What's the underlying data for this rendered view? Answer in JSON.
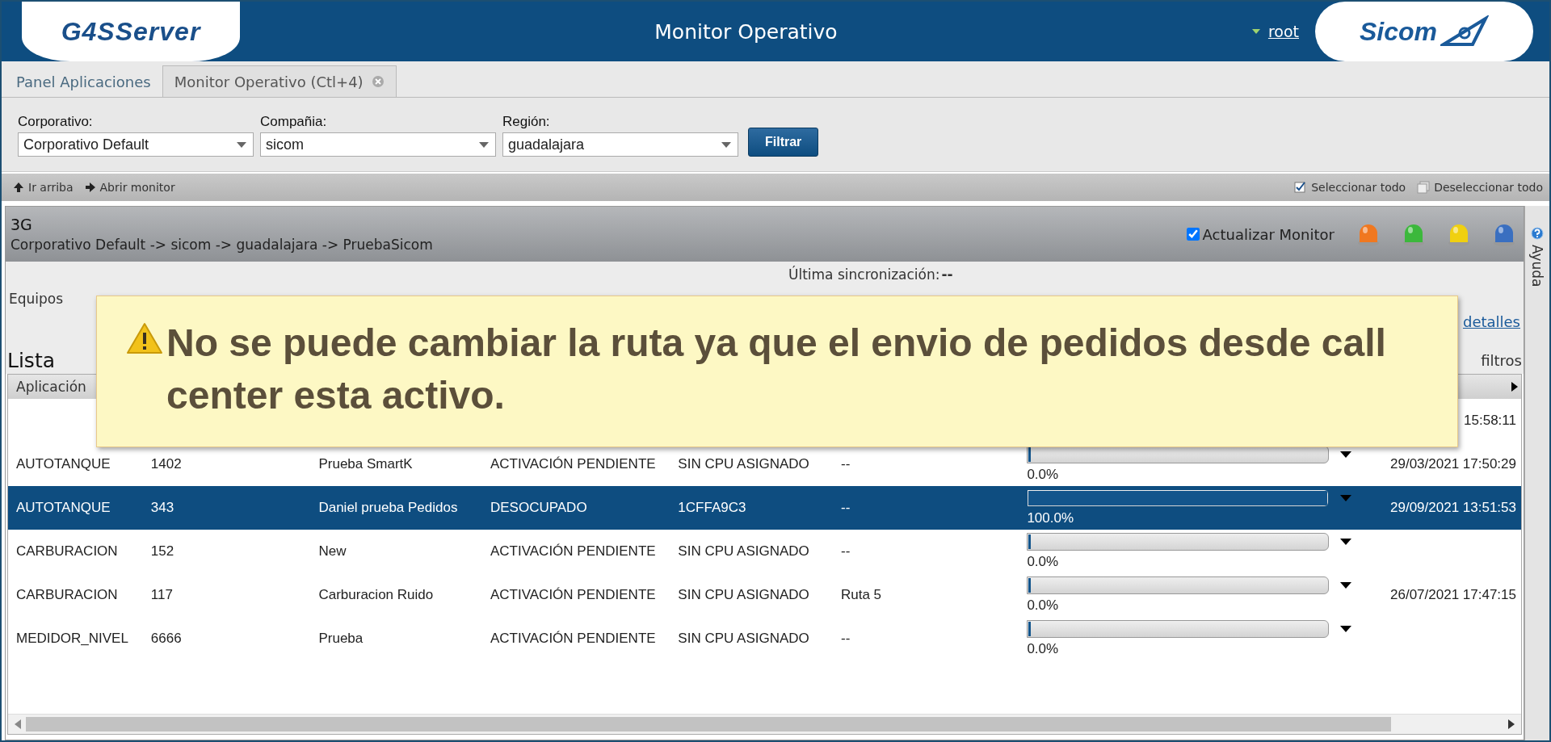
{
  "header": {
    "left_logo": "G4SServer",
    "title": "Monitor Operativo",
    "user": "root",
    "right_logo": "Sicom"
  },
  "tabs": [
    {
      "label": "Panel Aplicaciones",
      "selected": false,
      "closable": false
    },
    {
      "label": "Monitor Operativo (Ctl+4)",
      "selected": true,
      "closable": true
    }
  ],
  "filters": [
    {
      "label": "Corporativo:",
      "value": "Corporativo Default"
    },
    {
      "label": "Compañia:",
      "value": "sicom"
    },
    {
      "label": "Región:",
      "value": "guadalajara"
    }
  ],
  "filter_button": "Filtrar",
  "toolbar": {
    "left": [
      {
        "kind": "up",
        "label": "Ir arriba"
      },
      {
        "kind": "right",
        "label": "Abrir monitor"
      }
    ],
    "right": [
      {
        "kind": "check",
        "label": "Seleccionar todo"
      },
      {
        "kind": "uncheck",
        "label": "Deseleccionar todo"
      }
    ]
  },
  "panel": {
    "title": "3G",
    "path": "Corporativo Default -> sicom -> guadalajara -> PruebaSicom",
    "auto_update": {
      "label": "Actualizar Monitor",
      "checked": true
    },
    "lights": [
      {
        "color": "#f07820"
      },
      {
        "color": "#3cb83c"
      },
      {
        "color": "#f0d010"
      },
      {
        "color": "#3a6fc0"
      }
    ]
  },
  "details": {
    "linked_label": "Equipos",
    "last_sync_label": "Última sincronización:",
    "last_sync_value": "--",
    "hide_link": "detalles",
    "show_filters_label": "filtros"
  },
  "list_title": "Lista",
  "table": {
    "columns": [
      "Aplicación"
    ],
    "rows": [
      {
        "last": "15:58:11",
        "selected": false
      },
      {
        "cells": [
          "AUTOTANQUE",
          "1402",
          "Prueba SmartK",
          "ACTIVACIÓN PENDIENTE",
          "SIN CPU ASIGNADO",
          "--"
        ],
        "level": 0,
        "sync": "0.0%",
        "last": "29/03/2021 17:50:29",
        "selected": false
      },
      {
        "cells": [
          "AUTOTANQUE",
          "343",
          "Daniel prueba Pedidos",
          "DESOCUPADO",
          "1CFFA9C3",
          "--"
        ],
        "level": 1,
        "sync": "100.0%",
        "last": "29/09/2021 13:51:53",
        "selected": true
      },
      {
        "cells": [
          "CARBURACION",
          "152",
          "New",
          "ACTIVACIÓN PENDIENTE",
          "SIN CPU ASIGNADO",
          "--"
        ],
        "level": 0,
        "sync": "0.0%",
        "selected": false
      },
      {
        "cells": [
          "CARBURACION",
          "117",
          "Carburacion Ruido",
          "ACTIVACIÓN PENDIENTE",
          "SIN CPU ASIGNADO",
          "Ruta 5"
        ],
        "level": 0,
        "sync": "0.0%",
        "last": "26/07/2021 17:47:15",
        "selected": false
      },
      {
        "cells": [
          "MEDIDOR_NIVEL",
          "6666",
          "Prueba",
          "ACTIVACIÓN PENDIENTE",
          "SIN CPU ASIGNADO",
          "--"
        ],
        "level": 0,
        "sync": "0.0%",
        "selected": false
      }
    ]
  },
  "help_tab": "Ayuda",
  "toast": {
    "message": "No se puede cambiar la ruta ya que el envio de pedidos desde call center esta activo."
  }
}
